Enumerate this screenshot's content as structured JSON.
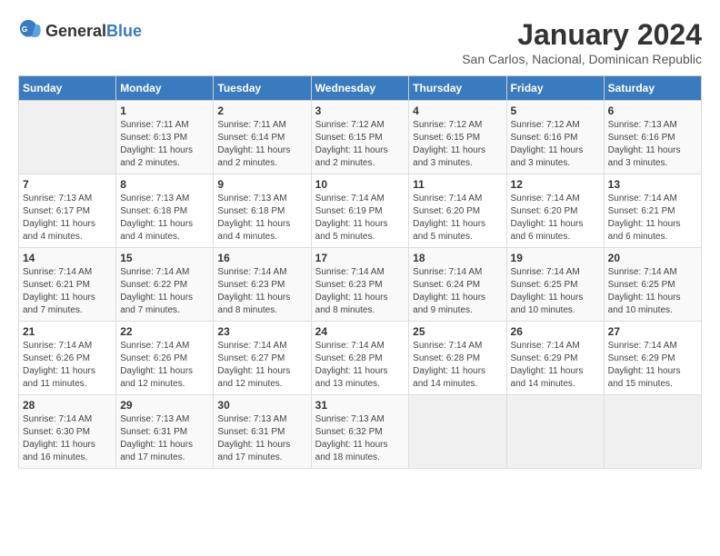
{
  "header": {
    "logo_general": "General",
    "logo_blue": "Blue",
    "month_title": "January 2024",
    "location": "San Carlos, Nacional, Dominican Republic"
  },
  "days_of_week": [
    "Sunday",
    "Monday",
    "Tuesday",
    "Wednesday",
    "Thursday",
    "Friday",
    "Saturday"
  ],
  "weeks": [
    [
      {
        "day": "",
        "sunrise": "",
        "sunset": "",
        "daylight": "",
        "empty": true
      },
      {
        "day": "1",
        "sunrise": "Sunrise: 7:11 AM",
        "sunset": "Sunset: 6:13 PM",
        "daylight": "Daylight: 11 hours and 2 minutes."
      },
      {
        "day": "2",
        "sunrise": "Sunrise: 7:11 AM",
        "sunset": "Sunset: 6:14 PM",
        "daylight": "Daylight: 11 hours and 2 minutes."
      },
      {
        "day": "3",
        "sunrise": "Sunrise: 7:12 AM",
        "sunset": "Sunset: 6:15 PM",
        "daylight": "Daylight: 11 hours and 2 minutes."
      },
      {
        "day": "4",
        "sunrise": "Sunrise: 7:12 AM",
        "sunset": "Sunset: 6:15 PM",
        "daylight": "Daylight: 11 hours and 3 minutes."
      },
      {
        "day": "5",
        "sunrise": "Sunrise: 7:12 AM",
        "sunset": "Sunset: 6:16 PM",
        "daylight": "Daylight: 11 hours and 3 minutes."
      },
      {
        "day": "6",
        "sunrise": "Sunrise: 7:13 AM",
        "sunset": "Sunset: 6:16 PM",
        "daylight": "Daylight: 11 hours and 3 minutes."
      }
    ],
    [
      {
        "day": "7",
        "sunrise": "Sunrise: 7:13 AM",
        "sunset": "Sunset: 6:17 PM",
        "daylight": "Daylight: 11 hours and 4 minutes."
      },
      {
        "day": "8",
        "sunrise": "Sunrise: 7:13 AM",
        "sunset": "Sunset: 6:18 PM",
        "daylight": "Daylight: 11 hours and 4 minutes."
      },
      {
        "day": "9",
        "sunrise": "Sunrise: 7:13 AM",
        "sunset": "Sunset: 6:18 PM",
        "daylight": "Daylight: 11 hours and 4 minutes."
      },
      {
        "day": "10",
        "sunrise": "Sunrise: 7:14 AM",
        "sunset": "Sunset: 6:19 PM",
        "daylight": "Daylight: 11 hours and 5 minutes."
      },
      {
        "day": "11",
        "sunrise": "Sunrise: 7:14 AM",
        "sunset": "Sunset: 6:20 PM",
        "daylight": "Daylight: 11 hours and 5 minutes."
      },
      {
        "day": "12",
        "sunrise": "Sunrise: 7:14 AM",
        "sunset": "Sunset: 6:20 PM",
        "daylight": "Daylight: 11 hours and 6 minutes."
      },
      {
        "day": "13",
        "sunrise": "Sunrise: 7:14 AM",
        "sunset": "Sunset: 6:21 PM",
        "daylight": "Daylight: 11 hours and 6 minutes."
      }
    ],
    [
      {
        "day": "14",
        "sunrise": "Sunrise: 7:14 AM",
        "sunset": "Sunset: 6:21 PM",
        "daylight": "Daylight: 11 hours and 7 minutes."
      },
      {
        "day": "15",
        "sunrise": "Sunrise: 7:14 AM",
        "sunset": "Sunset: 6:22 PM",
        "daylight": "Daylight: 11 hours and 7 minutes."
      },
      {
        "day": "16",
        "sunrise": "Sunrise: 7:14 AM",
        "sunset": "Sunset: 6:23 PM",
        "daylight": "Daylight: 11 hours and 8 minutes."
      },
      {
        "day": "17",
        "sunrise": "Sunrise: 7:14 AM",
        "sunset": "Sunset: 6:23 PM",
        "daylight": "Daylight: 11 hours and 8 minutes."
      },
      {
        "day": "18",
        "sunrise": "Sunrise: 7:14 AM",
        "sunset": "Sunset: 6:24 PM",
        "daylight": "Daylight: 11 hours and 9 minutes."
      },
      {
        "day": "19",
        "sunrise": "Sunrise: 7:14 AM",
        "sunset": "Sunset: 6:25 PM",
        "daylight": "Daylight: 11 hours and 10 minutes."
      },
      {
        "day": "20",
        "sunrise": "Sunrise: 7:14 AM",
        "sunset": "Sunset: 6:25 PM",
        "daylight": "Daylight: 11 hours and 10 minutes."
      }
    ],
    [
      {
        "day": "21",
        "sunrise": "Sunrise: 7:14 AM",
        "sunset": "Sunset: 6:26 PM",
        "daylight": "Daylight: 11 hours and 11 minutes."
      },
      {
        "day": "22",
        "sunrise": "Sunrise: 7:14 AM",
        "sunset": "Sunset: 6:26 PM",
        "daylight": "Daylight: 11 hours and 12 minutes."
      },
      {
        "day": "23",
        "sunrise": "Sunrise: 7:14 AM",
        "sunset": "Sunset: 6:27 PM",
        "daylight": "Daylight: 11 hours and 12 minutes."
      },
      {
        "day": "24",
        "sunrise": "Sunrise: 7:14 AM",
        "sunset": "Sunset: 6:28 PM",
        "daylight": "Daylight: 11 hours and 13 minutes."
      },
      {
        "day": "25",
        "sunrise": "Sunrise: 7:14 AM",
        "sunset": "Sunset: 6:28 PM",
        "daylight": "Daylight: 11 hours and 14 minutes."
      },
      {
        "day": "26",
        "sunrise": "Sunrise: 7:14 AM",
        "sunset": "Sunset: 6:29 PM",
        "daylight": "Daylight: 11 hours and 14 minutes."
      },
      {
        "day": "27",
        "sunrise": "Sunrise: 7:14 AM",
        "sunset": "Sunset: 6:29 PM",
        "daylight": "Daylight: 11 hours and 15 minutes."
      }
    ],
    [
      {
        "day": "28",
        "sunrise": "Sunrise: 7:14 AM",
        "sunset": "Sunset: 6:30 PM",
        "daylight": "Daylight: 11 hours and 16 minutes."
      },
      {
        "day": "29",
        "sunrise": "Sunrise: 7:13 AM",
        "sunset": "Sunset: 6:31 PM",
        "daylight": "Daylight: 11 hours and 17 minutes."
      },
      {
        "day": "30",
        "sunrise": "Sunrise: 7:13 AM",
        "sunset": "Sunset: 6:31 PM",
        "daylight": "Daylight: 11 hours and 17 minutes."
      },
      {
        "day": "31",
        "sunrise": "Sunrise: 7:13 AM",
        "sunset": "Sunset: 6:32 PM",
        "daylight": "Daylight: 11 hours and 18 minutes."
      },
      {
        "day": "",
        "sunrise": "",
        "sunset": "",
        "daylight": "",
        "empty": true
      },
      {
        "day": "",
        "sunrise": "",
        "sunset": "",
        "daylight": "",
        "empty": true
      },
      {
        "day": "",
        "sunrise": "",
        "sunset": "",
        "daylight": "",
        "empty": true
      }
    ]
  ]
}
